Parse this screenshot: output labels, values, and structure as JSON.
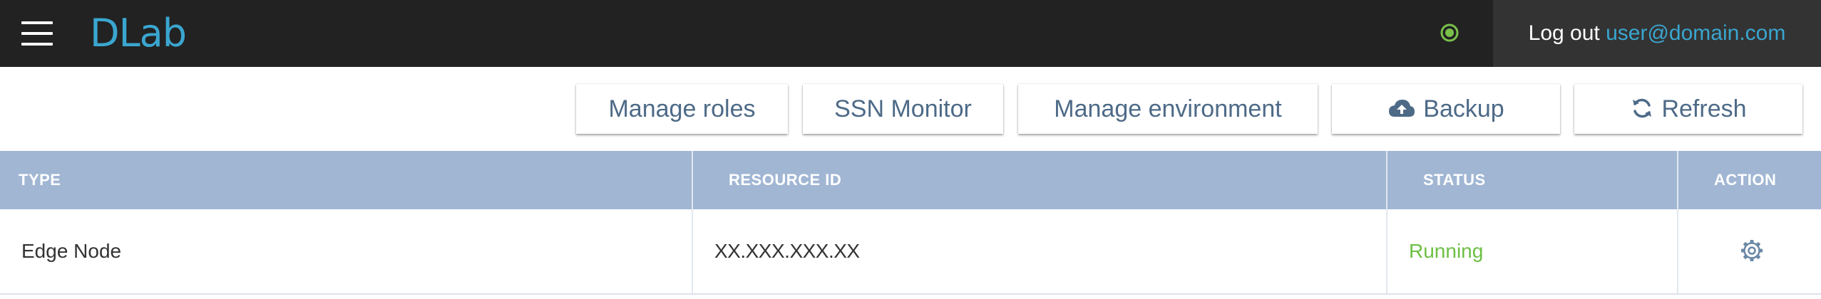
{
  "header": {
    "logo": "DLab",
    "logout_label": "Log out",
    "user": "user@domain.com",
    "status_color": "#7ac14a"
  },
  "toolbar": {
    "manage_roles": "Manage roles",
    "ssn_monitor": "SSN Monitor",
    "manage_environment": "Manage environment",
    "backup": "Backup",
    "refresh": "Refresh"
  },
  "table": {
    "columns": [
      "TYPE",
      "RESOURCE ID",
      "STATUS",
      "ACTION"
    ],
    "rows": [
      {
        "type": "Edge Node",
        "resource_id": "XX.XXX.XXX.XX",
        "status": "Running",
        "action_icon": "gear-icon"
      }
    ]
  },
  "colors": {
    "accent": "#3aa6cf",
    "header_bg": "#a0b6d3",
    "status_running": "#6cbf43"
  }
}
